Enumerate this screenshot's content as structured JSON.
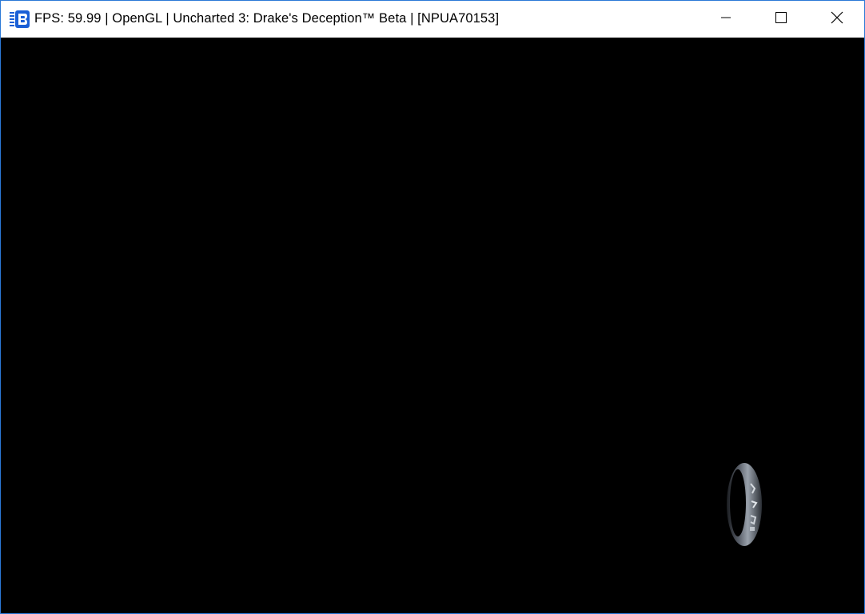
{
  "window": {
    "title": "FPS: 59.99 | OpenGL | Uncharted 3: Drake's Deception™ Beta | [NPUA70153]",
    "app_icon": "rpcs3-logo-icon",
    "controls": {
      "minimize_icon": "minimize-icon",
      "maximize_icon": "maximize-icon",
      "close_icon": "close-icon"
    },
    "border_color": "#2b79d7"
  },
  "viewport": {
    "background_color": "#000000",
    "scene_object": "rotating-ring-icon"
  }
}
